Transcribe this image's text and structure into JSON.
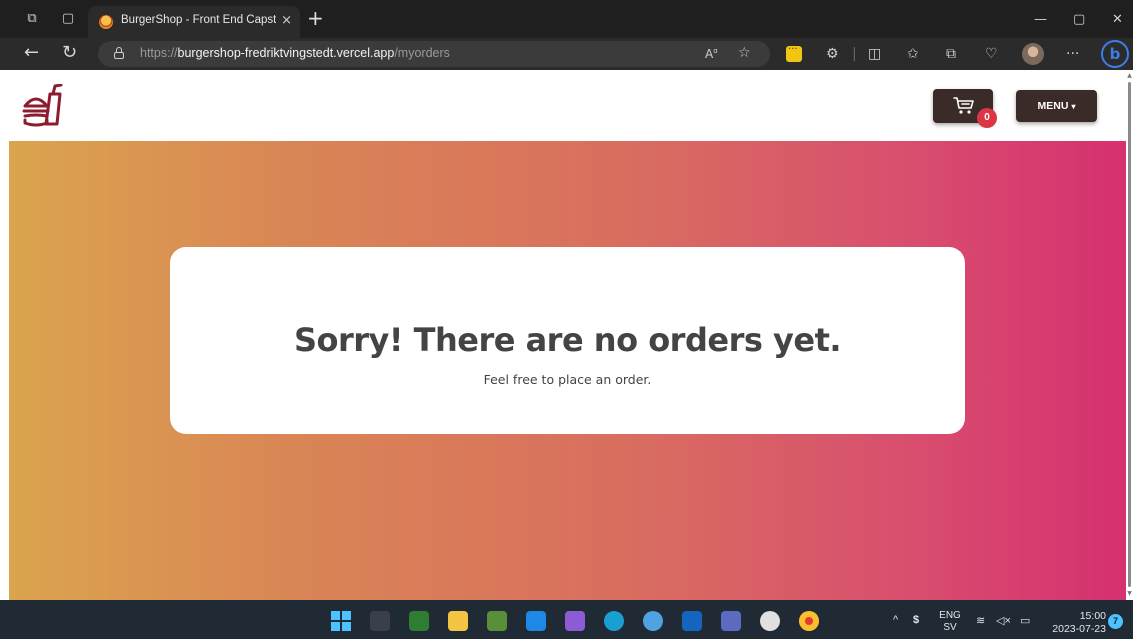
{
  "browser": {
    "tab_title": "BurgerShop - Front End Capstone",
    "tab_close": "×",
    "new_tab": "+",
    "url_prefix": "https://",
    "url_host": "burgershop-fredriktvingstedt.vercel.app",
    "url_path": "/myorders",
    "more_label": "···"
  },
  "header": {
    "cart_count": "0",
    "menu_label": "MENU",
    "menu_caret": "▾"
  },
  "empty_state": {
    "title": "Sorry! There are no orders yet.",
    "subtitle": "Feel free to place an order."
  },
  "taskbar": {
    "language_line1": "ENG",
    "language_line2": "SV",
    "time": "15:00",
    "date": "2023-07-23",
    "notification_count": "7"
  },
  "colors": {
    "brand_dark": "#3a2a28",
    "badge_red": "#dc3545",
    "logo_color": "#8c1d2e",
    "gradient_start": "#dba44e",
    "gradient_end": "#d63070"
  }
}
